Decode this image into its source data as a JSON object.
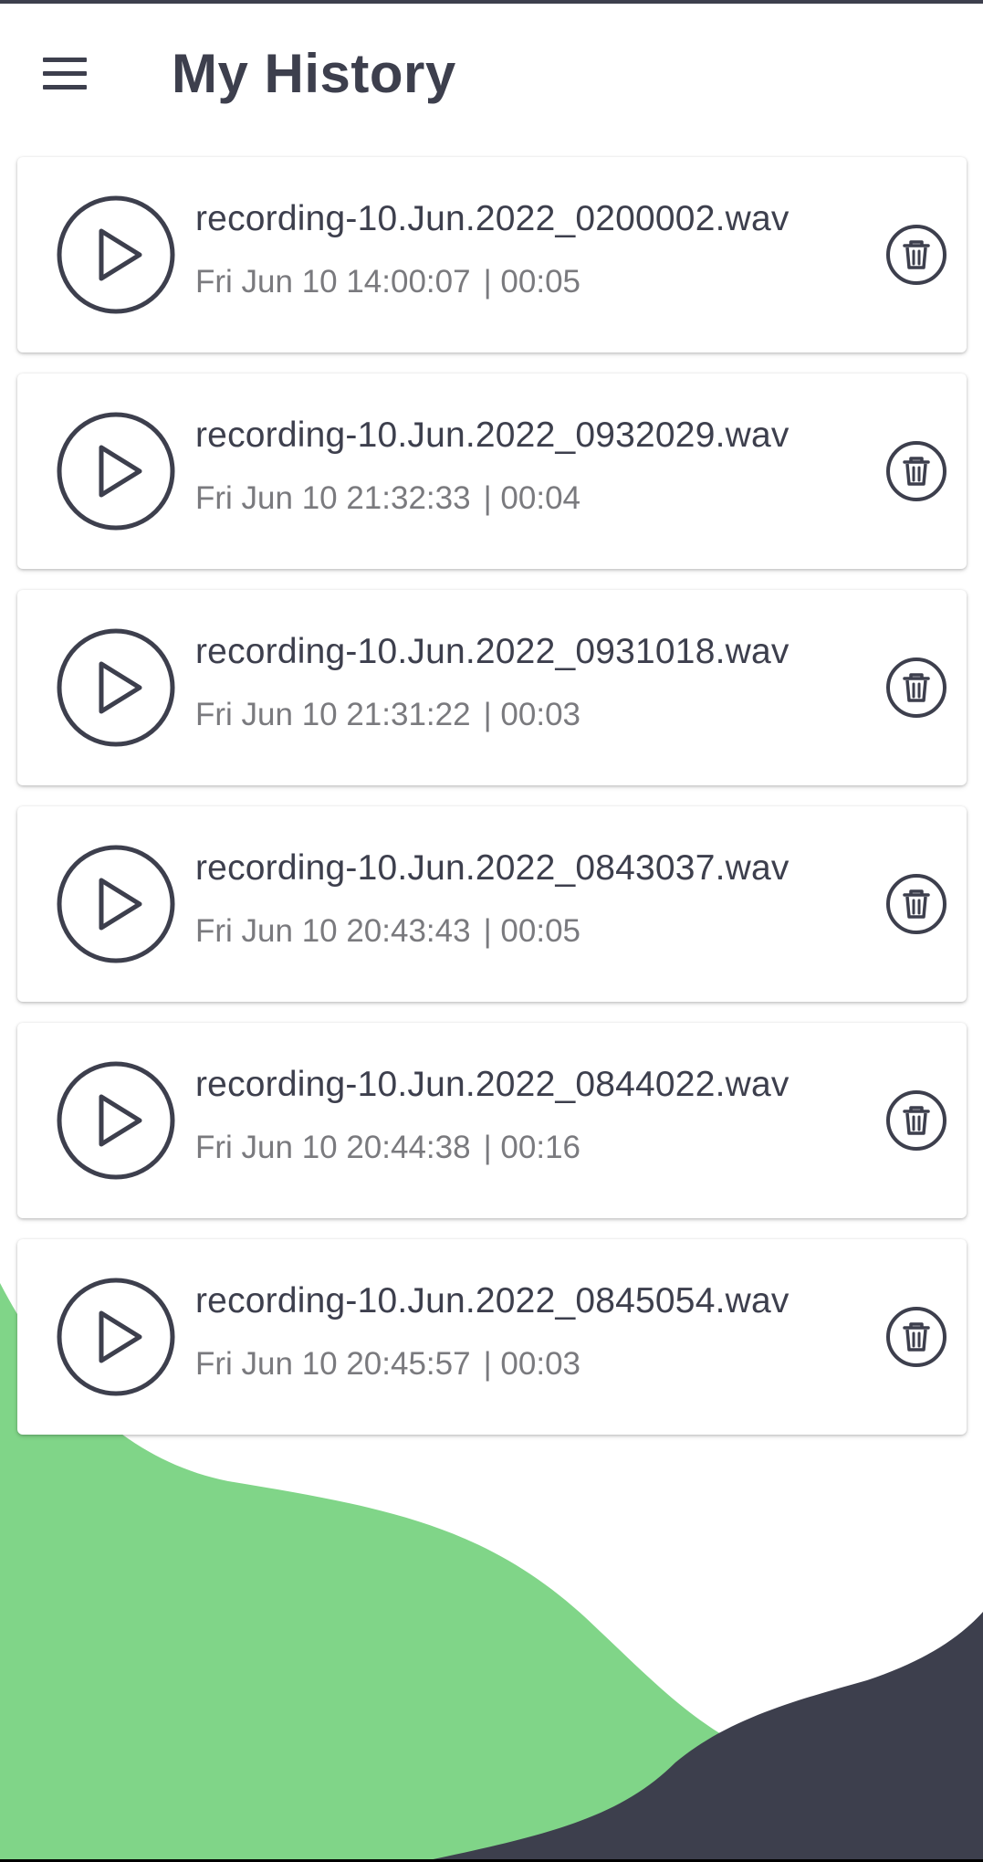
{
  "header": {
    "title": "My History",
    "menu_icon": "hamburger-menu-icon"
  },
  "colors": {
    "primary_dark": "#3d3f4d",
    "accent_green": "#80d588",
    "meta_gray": "#7a7a7e",
    "background": "#ffffff"
  },
  "recordings": [
    {
      "name": "recording-10.Jun.2022_0200002.wav",
      "timestamp": "Fri Jun 10 14:00:07",
      "separator": "|",
      "duration": "00:05"
    },
    {
      "name": "recording-10.Jun.2022_0932029.wav",
      "timestamp": "Fri Jun 10 21:32:33",
      "separator": "|",
      "duration": "00:04"
    },
    {
      "name": "recording-10.Jun.2022_0931018.wav",
      "timestamp": "Fri Jun 10 21:31:22",
      "separator": "|",
      "duration": "00:03"
    },
    {
      "name": "recording-10.Jun.2022_0843037.wav",
      "timestamp": "Fri Jun 10 20:43:43",
      "separator": "|",
      "duration": "00:05"
    },
    {
      "name": "recording-10.Jun.2022_0844022.wav",
      "timestamp": "Fri Jun 10 20:44:38",
      "separator": "|",
      "duration": "00:16"
    },
    {
      "name": "recording-10.Jun.2022_0845054.wav",
      "timestamp": "Fri Jun 10 20:45:57",
      "separator": "|",
      "duration": "00:03"
    }
  ],
  "icons": {
    "play": "play-circle-icon",
    "delete": "trash-icon"
  }
}
